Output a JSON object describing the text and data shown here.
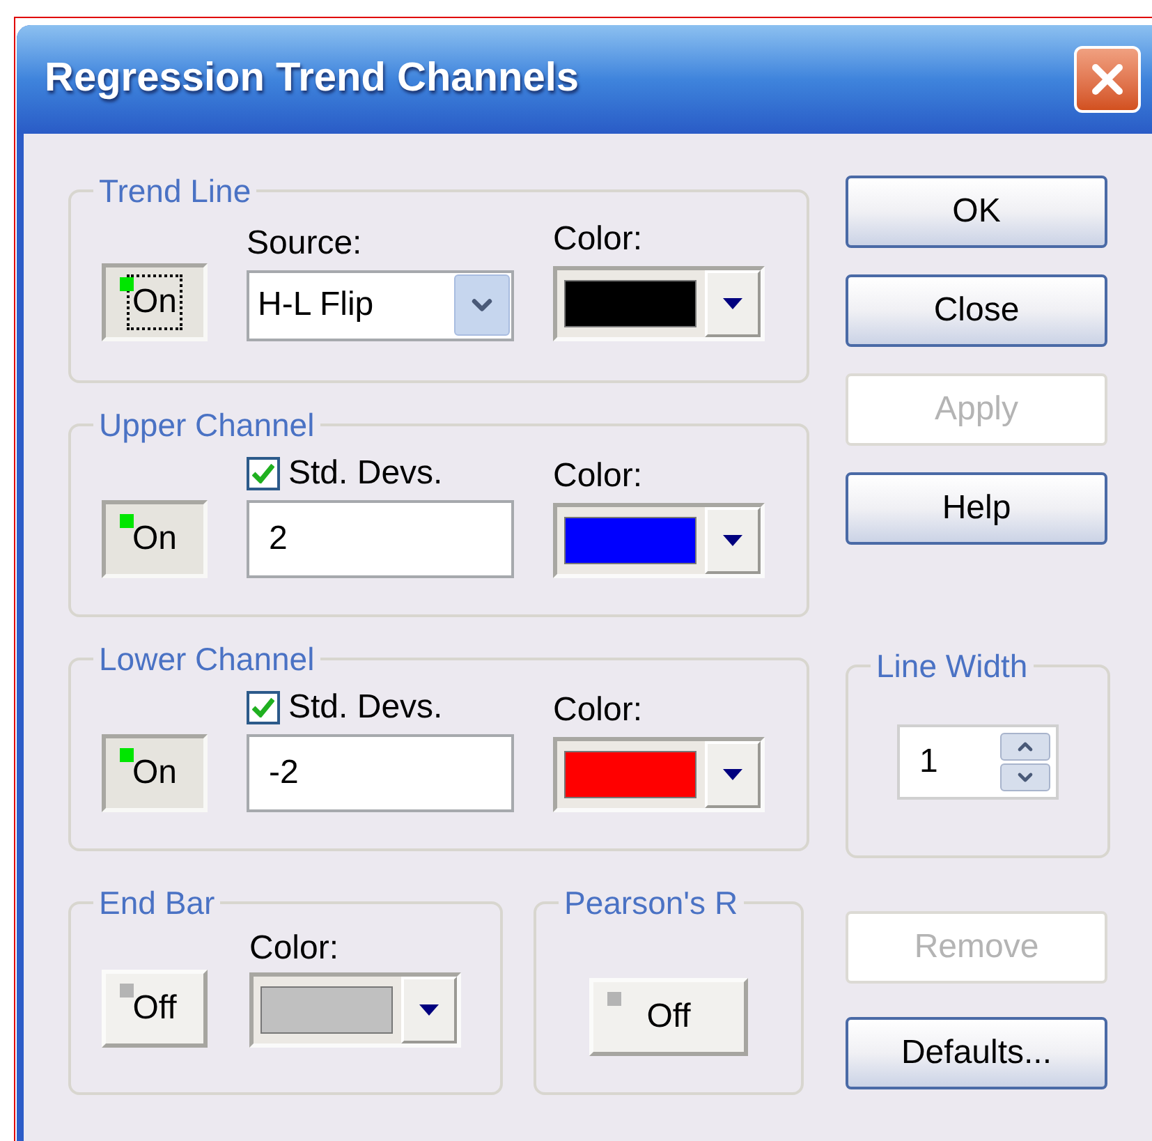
{
  "window": {
    "title": "Regression Trend Channels"
  },
  "groups": [
    {
      "kind": "source",
      "title": "Trend Line",
      "toggle": {
        "label": "On",
        "on": true,
        "focused": true
      },
      "field": {
        "label": "Source:",
        "value": "H-L Flip"
      },
      "color": {
        "label": "Color:",
        "color": "#000000"
      }
    },
    {
      "kind": "devs",
      "title": "Upper Channel",
      "toggle": {
        "label": "On",
        "on": true,
        "focused": false
      },
      "field": {
        "label": "Std. Devs.",
        "checked": true,
        "value": "2"
      },
      "color": {
        "label": "Color:",
        "color": "#0000ff"
      }
    },
    {
      "kind": "devs",
      "title": "Lower Channel",
      "toggle": {
        "label": "On",
        "on": true,
        "focused": false
      },
      "field": {
        "label": "Std. Devs.",
        "checked": true,
        "value": "-2"
      },
      "color": {
        "label": "Color:",
        "color": "#ff0000"
      }
    }
  ],
  "end_bar": {
    "title": "End Bar",
    "toggle": {
      "label": "Off",
      "on": false,
      "focused": false
    },
    "color": {
      "label": "Color:",
      "color": "#c0c0c0"
    }
  },
  "pearsons_r": {
    "title": "Pearson's R",
    "toggle": {
      "label": "Off",
      "on": false,
      "focused": false
    }
  },
  "buttons": [
    {
      "label": "OK",
      "disabled": false
    },
    {
      "label": "Close",
      "disabled": false
    },
    {
      "label": "Apply",
      "disabled": true
    },
    {
      "label": "Help",
      "disabled": false
    }
  ],
  "line_width": {
    "title": "Line Width",
    "value": "1"
  },
  "bottom_buttons": [
    {
      "label": "Remove",
      "disabled": true
    },
    {
      "label": "Defaults...",
      "disabled": false
    }
  ]
}
